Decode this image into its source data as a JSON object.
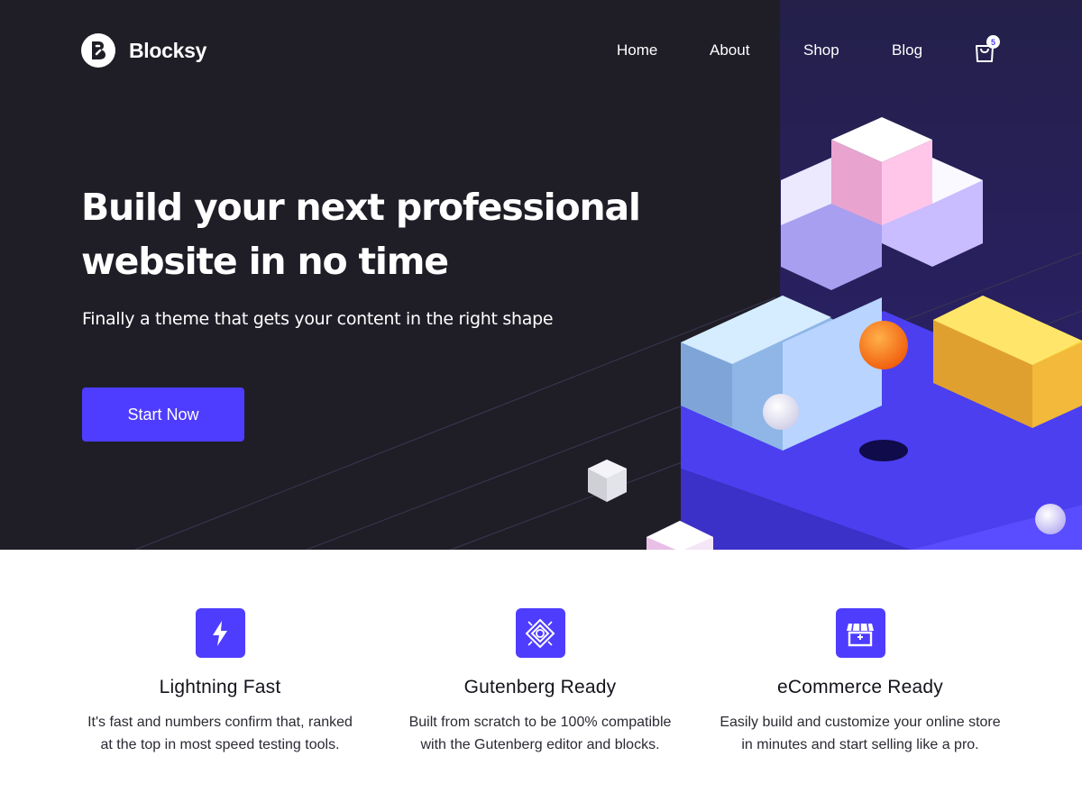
{
  "brand": {
    "name": "Blocksy",
    "icon": "blocksy-logo-icon"
  },
  "nav": {
    "items": [
      {
        "label": "Home"
      },
      {
        "label": "About"
      },
      {
        "label": "Shop"
      },
      {
        "label": "Blog"
      }
    ],
    "cart": {
      "icon": "shopping-bag-icon",
      "count": "5"
    }
  },
  "hero": {
    "headline_line1": "Build your next professional",
    "headline_line2": "website in no time",
    "subheadline": "Finally a theme that gets your content in the right shape",
    "cta_label": "Start Now"
  },
  "features": [
    {
      "icon": "lightning-icon",
      "title": "Lightning Fast",
      "desc_line1": "It's fast and numbers confirm that, ranked",
      "desc_line2": "at the top in most speed testing tools."
    },
    {
      "icon": "gutenberg-icon",
      "title": "Gutenberg Ready",
      "desc_line1": "Built from scratch to be 100% compatible",
      "desc_line2": "with the Gutenberg editor and blocks."
    },
    {
      "icon": "storefront-icon",
      "title": "eCommerce Ready",
      "desc_line1": "Easily build and customize your online store",
      "desc_line2": "in minutes and start selling like a pro."
    }
  ],
  "colors": {
    "hero_bg": "#1f1e27",
    "accent": "#4e3dff",
    "panel": "#281e5e"
  }
}
